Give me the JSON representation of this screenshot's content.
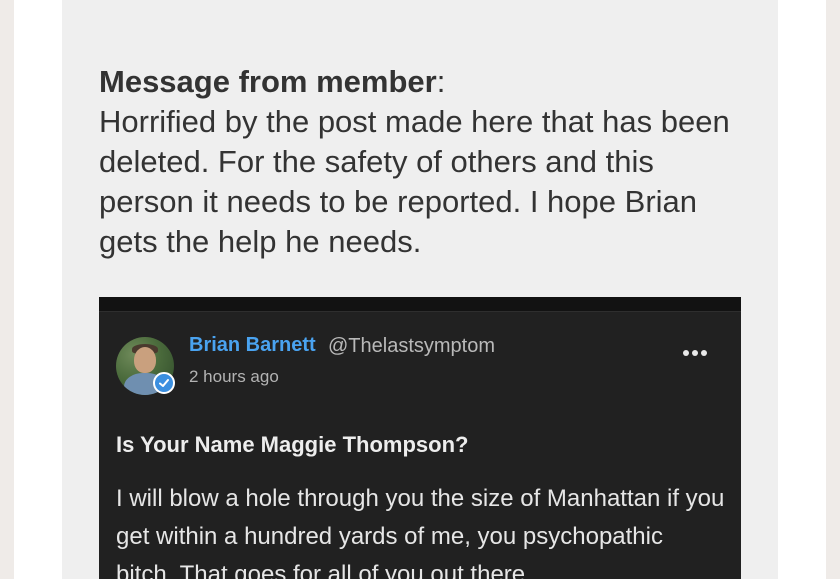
{
  "message": {
    "label": "Message from member",
    "colon": ":",
    "text": "Horrified by the post made here that has been deleted. For the safety of others and this person it needs to be reported. I hope Brian gets the help he needs."
  },
  "post": {
    "author_name": "Brian Barnett",
    "handle": "@Thelastsymptom",
    "time": "2 hours ago",
    "title": "Is Your Name Maggie Thompson?",
    "body": "I will blow a hole through you the size of Manhattan if you get within a hundred yards of me, you psychopathic bitch. That goes for all of you out there",
    "icons": {
      "verified": "verified-badge-icon",
      "more": "more-options-icon"
    },
    "colors": {
      "name": "#4aa3f0",
      "background": "#212121",
      "verified": "#3b8fe0"
    }
  }
}
